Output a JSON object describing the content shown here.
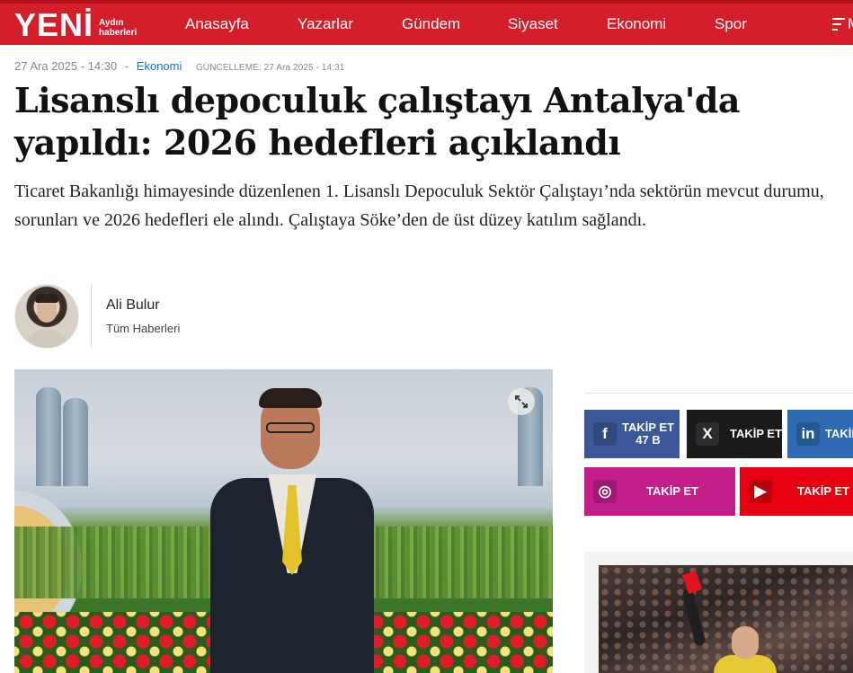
{
  "header": {
    "logo_main": "YENİ",
    "logo_sub_line1": "Aydın",
    "logo_sub_line2": "haberleri",
    "nav": [
      "Anasayfa",
      "Yazarlar",
      "Gündem",
      "Siyaset",
      "Ekonomi",
      "Spor"
    ],
    "menu_label": "M",
    "brand_color": "#d41e2c"
  },
  "article": {
    "date": "27 Ara 2025 - 14:30",
    "separator": "-",
    "category": "Ekonomi",
    "updated": "GÜNCELLEME: 27 Ara 2025 - 14:31",
    "title": "Lisanslı depoculuk çalıştayı Antalya'da yapıldı: 2026 hedefleri açıklandı",
    "summary": "Ticaret Bakanlığı himayesinde düzenlenen 1. Lisanslı Depoculuk Sektör Çalıştayı’nda sektörün mevcut durumu, sorunları ve 2026 hedefleri ele alındı. Çalıştaya Söke’den de üst düzey katılım sağlandı."
  },
  "author": {
    "name": "Ali Bulur",
    "link_label": "Tüm Haberleri"
  },
  "media": {
    "expand_icon": "expand-icon"
  },
  "social": {
    "facebook": {
      "label": "TAKİP ET",
      "count": "47 B",
      "icon": "f",
      "color": "#3b5998"
    },
    "x": {
      "label": "TAKİP ET",
      "icon": "X",
      "color": "#1a1a1a"
    },
    "linkedin": {
      "label": "TAKİP ET",
      "icon": "in",
      "color": "#2e6bb3"
    },
    "instagram": {
      "label": "TAKİP ET",
      "icon": "◎",
      "color": "#c41e8a"
    },
    "youtube": {
      "label": "TAKİP ET",
      "icon": "▶",
      "color": "#e60012"
    }
  }
}
